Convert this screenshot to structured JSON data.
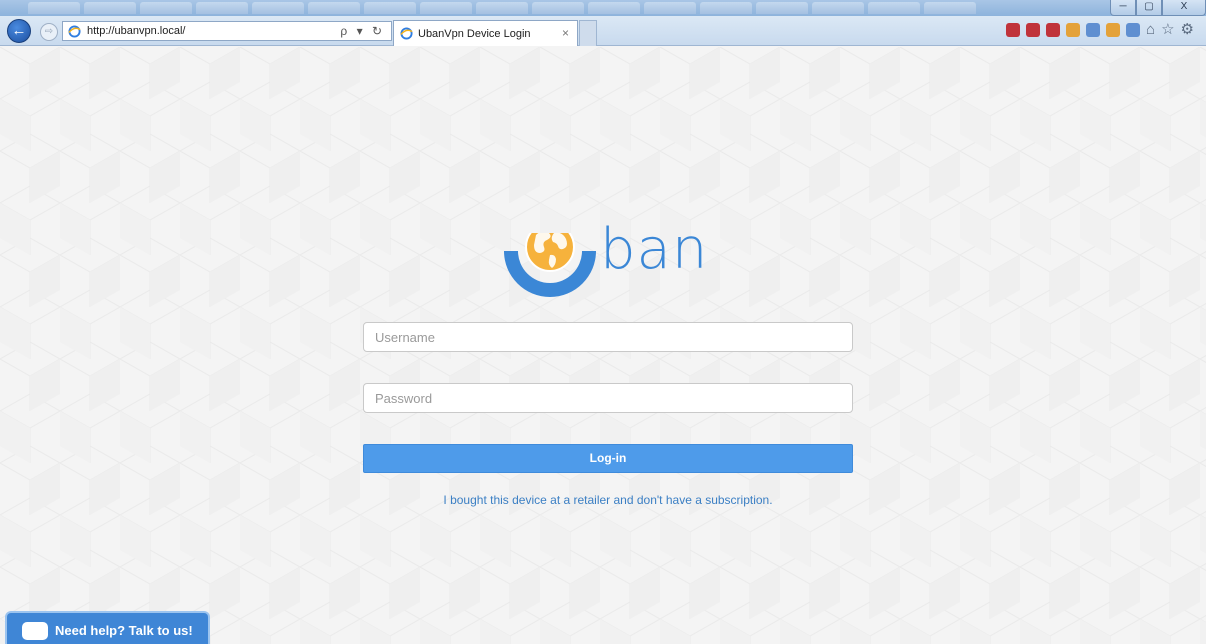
{
  "browser": {
    "address_url": "http://ubanvpn.local/",
    "tab_title": "UbanVpn Device Login",
    "tab_close": "×",
    "search_controls": "ρ ▾ ↻",
    "window_controls": {
      "minimize": "─",
      "maximize": "▢",
      "close": "X"
    }
  },
  "page": {
    "logo_text": "ban",
    "username_placeholder": "Username",
    "password_placeholder": "Password",
    "login_label": "Log-in",
    "retail_link": "I bought this device at a retailer and don't have a subscription.",
    "help_label": "Need help? Talk to us!"
  },
  "colors": {
    "brand_blue": "#3b87d6",
    "button_blue": "#4e9bea",
    "globe_orange": "#f4a628",
    "link_blue": "#3b7fc4"
  }
}
